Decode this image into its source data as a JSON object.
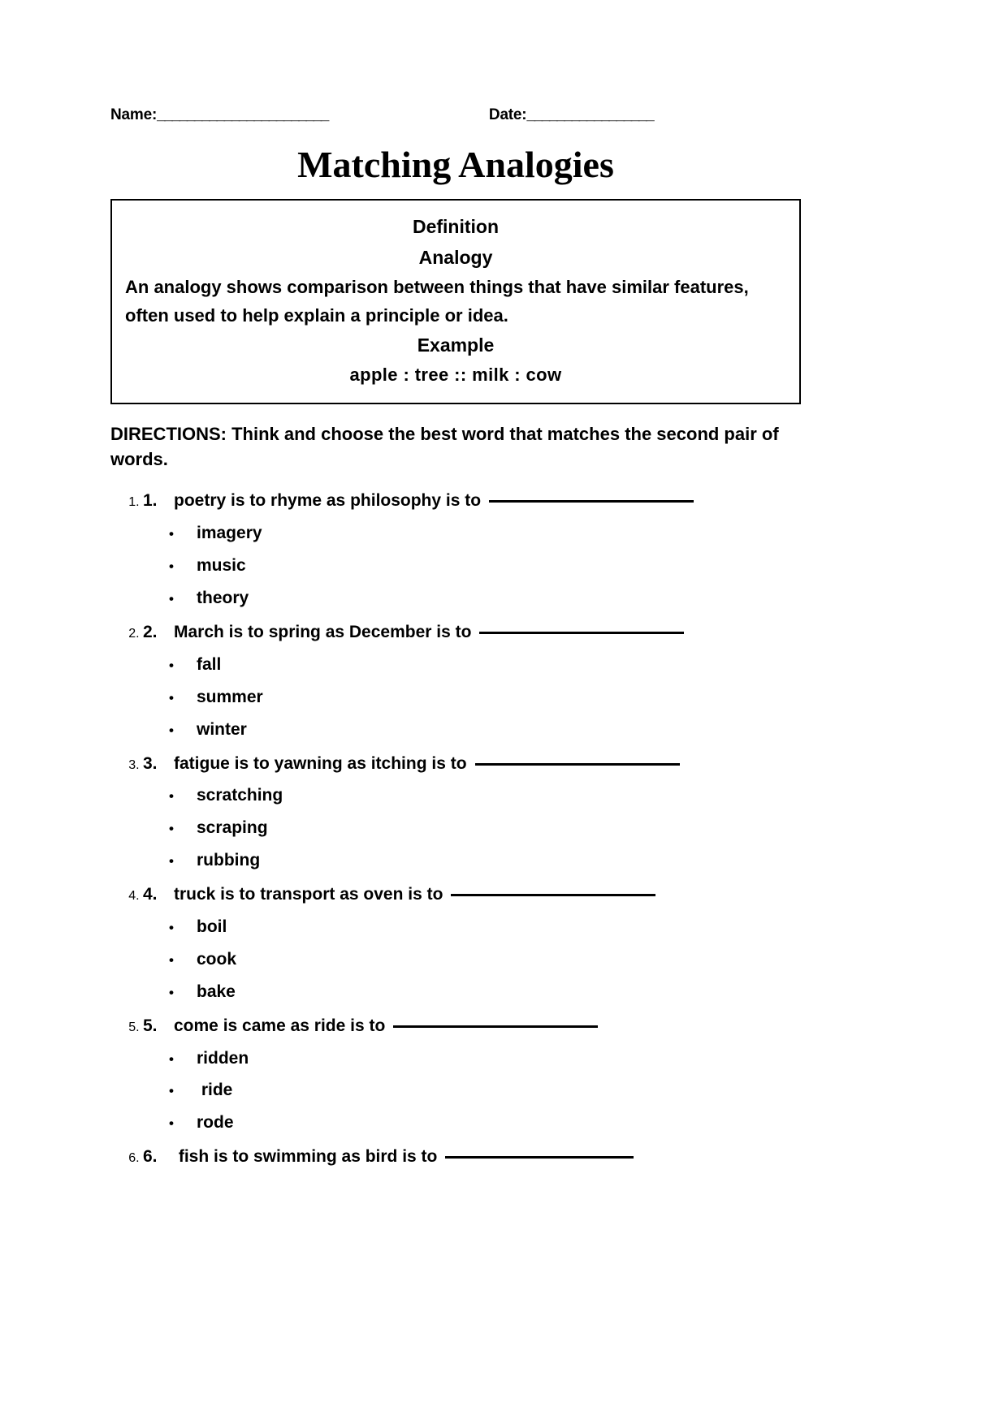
{
  "header": {
    "name_label": "Name:",
    "name_rule": "_______________________",
    "date_label": "Date:",
    "date_rule": "_________________"
  },
  "title": "Matching Analogies",
  "definition_box": {
    "heading": "Definition",
    "term": "Analogy",
    "body_line_1": "An analogy shows comparison between things that have similar features,",
    "body_line_2": "often used to help explain a principle or idea.",
    "example_label": "Example",
    "example": "apple : tree ::  milk :  cow"
  },
  "directions": "DIRECTIONS: Think and choose the best word that matches the second pair of words.",
  "questions": [
    {
      "number": "1.",
      "text": "poetry is to rhyme as philosophy is to",
      "blank_width": 252,
      "options": [
        "imagery",
        "music",
        "theory"
      ]
    },
    {
      "number": "2.",
      "text": "March is to spring as December is to",
      "blank_width": 252,
      "options": [
        "fall",
        "summer",
        "winter"
      ]
    },
    {
      "number": "3.",
      "text": "fatigue is to yawning as itching is to",
      "blank_width": 252,
      "options": [
        "scratching",
        "scraping",
        "rubbing"
      ]
    },
    {
      "number": "4.",
      "text": "truck is to transport as oven is to",
      "blank_width": 252,
      "options": [
        "boil",
        "cook",
        "bake"
      ]
    },
    {
      "number": "5.",
      "text": "come is came as ride is to",
      "blank_width": 252,
      "options": [
        "ridden",
        " ride",
        "rode"
      ]
    },
    {
      "number": "6.",
      "text": " fish is to swimming as bird is to",
      "blank_width": 232,
      "options": []
    }
  ],
  "icons": {
    "bullet_glyph": "•"
  }
}
